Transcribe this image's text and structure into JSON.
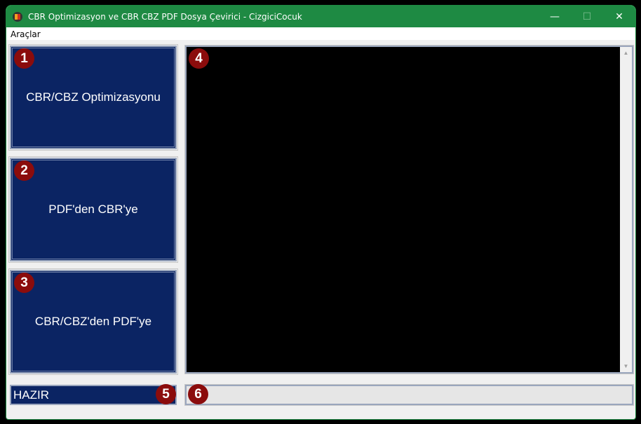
{
  "window": {
    "title": "CBR Optimizasyon ve CBR CBZ PDF Dosya Çevirici - CizgiciCocuk",
    "minimize": "—",
    "maximize": "☐",
    "close": "✕"
  },
  "menu": {
    "items": [
      {
        "label": "Araçlar"
      }
    ]
  },
  "buttons": [
    {
      "label": "CBR/CBZ Optimizasyonu",
      "badge": "1"
    },
    {
      "label": "PDF'den CBR'ye",
      "badge": "2"
    },
    {
      "label": "CBR/CBZ'den PDF'ye",
      "badge": "3"
    }
  ],
  "display": {
    "badge": "4",
    "scroll_up": "▲",
    "scroll_down": "▼"
  },
  "status": {
    "text": "HAZIR",
    "badge": "5"
  },
  "progress": {
    "value": 0,
    "badge": "6"
  }
}
